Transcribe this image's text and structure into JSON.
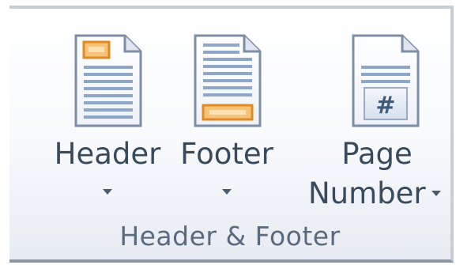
{
  "group": {
    "title": "Header & Footer"
  },
  "buttons": {
    "header": {
      "label": "Header",
      "icon": "header-page-icon"
    },
    "footer": {
      "label": "Footer",
      "icon": "footer-page-icon"
    },
    "page_number": {
      "label_line1": "Page",
      "label_line2": "Number",
      "icon": "page-number-icon",
      "glyph": "#"
    }
  },
  "colors": {
    "label_text": "#384a5c",
    "group_label_text": "#5a6b7e",
    "highlight_orange": "#f0a64a",
    "page_lines": "#8ea7c9"
  }
}
